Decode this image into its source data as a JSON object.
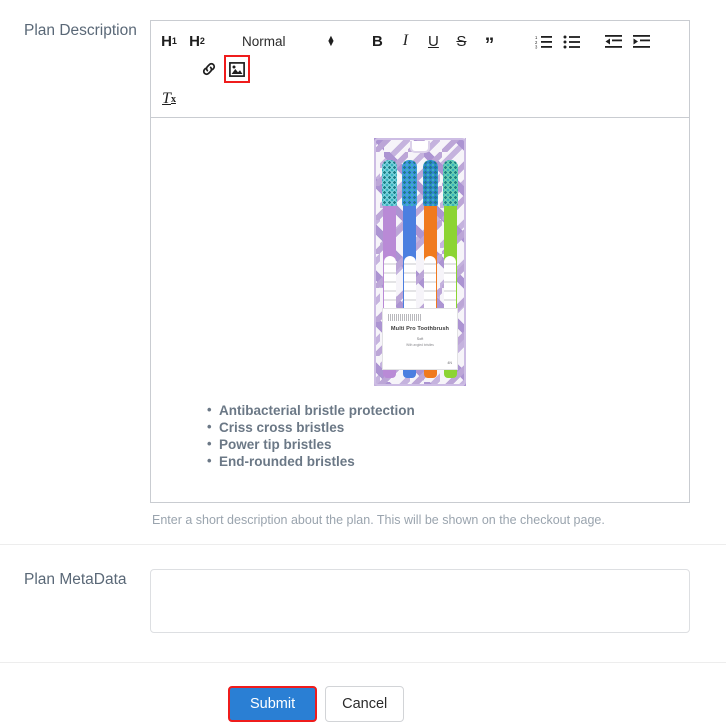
{
  "form": {
    "description": {
      "label": "Plan Description",
      "help_text": "Enter a short description about the plan. This will be shown on the checkout page."
    },
    "metadata": {
      "label": "Plan MetaData",
      "value": "",
      "placeholder": ""
    }
  },
  "editor": {
    "toolbar": {
      "h1_label": "H",
      "h1_sub": "1",
      "h2_label": "H",
      "h2_sub": "2",
      "format_picker": "Normal",
      "bold_label": "B",
      "italic_label": "I",
      "underline_label": "U",
      "strike_label": "S",
      "blockquote_label": "”",
      "clear_format_label": "T",
      "clear_format_sub": "x",
      "ordered_list_name": "ordered-list",
      "bullet_list_name": "bullet-list",
      "outdent_name": "outdent",
      "indent_name": "indent",
      "link_name": "link",
      "image_name": "image",
      "highlighted_button": "image"
    },
    "content": {
      "image_alt": "Multi Pro Toothbrush 4-pack blister package",
      "bullets": [
        "Antibacterial bristle protection",
        "Criss cross bristles",
        "Power tip bristles",
        "End-rounded bristles"
      ]
    }
  },
  "product_image": {
    "label_title": "Multi Pro Toothbrush",
    "label_sub1": "Soft",
    "label_sub2": "With angled bristles",
    "label_qty": "4N",
    "brush_colors": [
      "#b98ad6",
      "#4b7fe0",
      "#f07a1e",
      "#8cd433"
    ]
  },
  "actions": {
    "submit_label": "Submit",
    "cancel_label": "Cancel"
  },
  "colors": {
    "submit_blue": "#2a7fd4",
    "highlight_red": "#ef1c1c",
    "label_gray": "#5a6877",
    "help_gray": "#9aa4ae"
  }
}
